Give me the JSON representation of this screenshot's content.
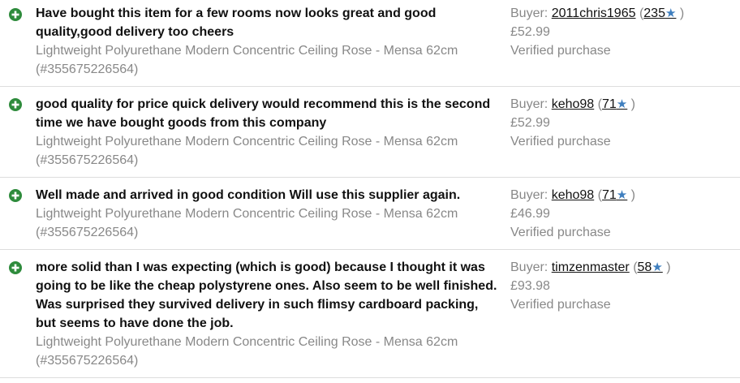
{
  "colors": {
    "positive_icon": "#2e8b3c",
    "star": "#3f7fbf",
    "muted_text": "#888888",
    "comment_text": "#111111",
    "divider": "#dddddd"
  },
  "icons": {
    "positive": "plus-circle-icon",
    "star": "star-icon"
  },
  "buyer_prefix": "Buyer:",
  "rows": [
    {
      "comment_lines": [
        "Have bought this item for a few rooms now looks great and good",
        "quality,good delivery too cheers"
      ],
      "item_line1": "Lightweight Polyurethane Modern Concentric Ceiling Rose - Mensa 62cm",
      "item_line2": "(#355675226564)",
      "buyer": "2011chris1965",
      "score": "235",
      "price": "£52.99",
      "status": "Verified purchase"
    },
    {
      "comment_lines": [
        "good quality for price quick delivery would recommend this is the second",
        "time we have bought goods from this company"
      ],
      "item_line1": "Lightweight Polyurethane Modern Concentric Ceiling Rose - Mensa 62cm",
      "item_line2": "(#355675226564)",
      "buyer": "keho98",
      "score": "71",
      "price": "£52.99",
      "status": "Verified purchase"
    },
    {
      "comment_lines": [
        "Well made and arrived in good condition Will use this supplier again."
      ],
      "item_line1": "Lightweight Polyurethane Modern Concentric Ceiling Rose - Mensa 62cm",
      "item_line2": "(#355675226564)",
      "buyer": "keho98",
      "score": "71",
      "price": "£46.99",
      "status": "Verified purchase"
    },
    {
      "comment_lines": [
        "more solid than I was expecting (which is good) because I thought it was",
        "going to be like the cheap polystyrene ones. Also seem to be well finished.",
        "Was surprised they survived delivery in such flimsy cardboard packing,",
        "but seems to have done the job."
      ],
      "item_line1": "Lightweight Polyurethane Modern Concentric Ceiling Rose - Mensa 62cm",
      "item_line2": "(#355675226564)",
      "buyer": "timzenmaster",
      "score": "58",
      "price": "£93.98",
      "status": "Verified purchase"
    }
  ]
}
